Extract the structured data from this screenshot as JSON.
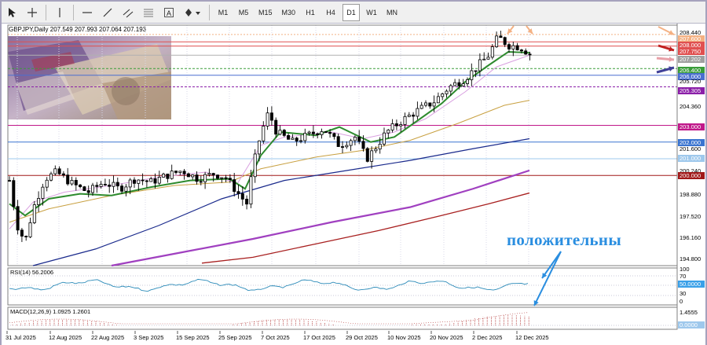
{
  "toolbar": {
    "timeframes": [
      "M1",
      "M5",
      "M15",
      "M30",
      "H1",
      "H4",
      "D1",
      "W1",
      "MN"
    ],
    "active_timeframe": "D1"
  },
  "chart": {
    "title": "GBPJPY,Daily  207.549 207.993 207.064 207.193",
    "overlay_text": "положительны",
    "price_labels": [
      {
        "text": "208.440",
        "color": "#000000",
        "bg": ""
      },
      {
        "text": "207.600",
        "color": "#ffffff",
        "bg": "#f4b183"
      },
      {
        "text": "208.000",
        "color": "#ffffff",
        "bg": "#e05050"
      },
      {
        "text": "207.750",
        "color": "#ffffff",
        "bg": "#e05050"
      },
      {
        "text": "207.202",
        "color": "#ffffff",
        "bg": "#a0a0a0"
      },
      {
        "text": "206.400",
        "color": "#ffffff",
        "bg": "#3a9d3a"
      },
      {
        "text": "206.000",
        "color": "#ffffff",
        "bg": "#4a6fd0"
      },
      {
        "text": "205.720",
        "color": "#000000",
        "bg": ""
      },
      {
        "text": "205.305",
        "color": "#ffffff",
        "bg": "#8b1fa8"
      },
      {
        "text": "204.360",
        "color": "#000000",
        "bg": ""
      },
      {
        "text": "203.000",
        "color": "#ffffff",
        "bg": "#c0188a"
      },
      {
        "text": "202.000",
        "color": "#ffffff",
        "bg": "#3a74d0"
      },
      {
        "text": "201.600",
        "color": "#000000",
        "bg": ""
      },
      {
        "text": "201.000",
        "color": "#ffffff",
        "bg": "#9ec8ec"
      },
      {
        "text": "200.240",
        "color": "#000000",
        "bg": ""
      },
      {
        "text": "200.000",
        "color": "#ffffff",
        "bg": "#a01818"
      },
      {
        "text": "198.880",
        "color": "#000000",
        "bg": ""
      },
      {
        "text": "197.520",
        "color": "#000000",
        "bg": ""
      },
      {
        "text": "196.160",
        "color": "#000000",
        "bg": ""
      },
      {
        "text": "194.800",
        "color": "#000000",
        "bg": ""
      }
    ],
    "date_labels": [
      "31 Jul 2025",
      "12 Aug 2025",
      "22 Aug 2025",
      "3 Sep 2025",
      "15 Sep 2025",
      "25 Sep 2025",
      "7 Oct 2025",
      "17 Oct 2025",
      "29 Oct 2025",
      "10 Nov 2025",
      "20 Nov 2025",
      "2 Dec 2025",
      "12 Dec 2025"
    ]
  },
  "rsi": {
    "title": "RSI(14) 56.2006",
    "levels": [
      "100",
      "70",
      "50.0000",
      "30",
      "0"
    ]
  },
  "macd": {
    "title": "MACD(12,26,9) 1.0925 1.2601",
    "levels": [
      "1.4555",
      "0.0000"
    ]
  },
  "colors": {
    "ma_fast": "#2e8b2e",
    "ma_mid": "#c8a040",
    "ma_slow": "#1a2a8c",
    "ma_purple": "#a040c0",
    "ma_red": "#a82020",
    "rsi_line": "#2a8ab8",
    "overlay_text": "#2a8ee0"
  }
}
